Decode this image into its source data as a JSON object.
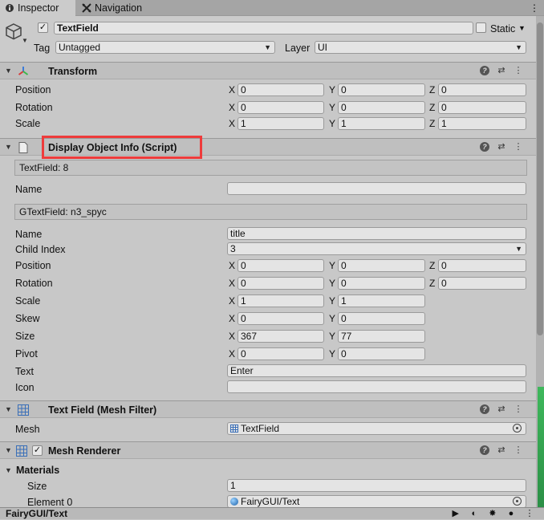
{
  "tabs": [
    {
      "label": "Inspector",
      "icon": "lock-info-icon",
      "active": true
    },
    {
      "label": "Navigation",
      "icon": "navigation-icon",
      "active": false
    }
  ],
  "tab_menu_icon": "kebab-menu-icon",
  "object": {
    "name": "TextField",
    "active_checked": true,
    "static_label": "Static",
    "tag_label": "Tag",
    "tag_value": "Untagged",
    "layer_label": "Layer",
    "layer_value": "UI"
  },
  "transform": {
    "title": "Transform",
    "position_label": "Position",
    "rotation_label": "Rotation",
    "scale_label": "Scale",
    "position": {
      "x": "0",
      "y": "0",
      "z": "0"
    },
    "rotation": {
      "x": "0",
      "y": "0",
      "z": "0"
    },
    "scale": {
      "x": "1",
      "y": "1",
      "z": "1"
    }
  },
  "axis": {
    "x": "X",
    "y": "Y",
    "z": "Z"
  },
  "display_info": {
    "title": "Display Object Info (Script)",
    "info1": "TextField: 8",
    "name_label1": "Name",
    "name_value1": "",
    "info2": "GTextField: n3_spyc",
    "name_label2": "Name",
    "name_value2": "title",
    "child_index_label": "Child Index",
    "child_index_value": "3",
    "position_label": "Position",
    "position": {
      "x": "0",
      "y": "0",
      "z": "0"
    },
    "rotation_label": "Rotation",
    "rotation": {
      "x": "0",
      "y": "0",
      "z": "0"
    },
    "scale_label": "Scale",
    "scale": {
      "x": "1",
      "y": "1"
    },
    "skew_label": "Skew",
    "skew": {
      "x": "0",
      "y": "0"
    },
    "size_label": "Size",
    "size": {
      "x": "367",
      "y": "77"
    },
    "pivot_label": "Pivot",
    "pivot": {
      "x": "0",
      "y": "0"
    },
    "text_label": "Text",
    "text_value": "Enter",
    "icon_label": "Icon",
    "icon_value": ""
  },
  "mesh_filter": {
    "title": "Text Field (Mesh Filter)",
    "mesh_label": "Mesh",
    "mesh_value": "TextField"
  },
  "mesh_renderer": {
    "title": "Mesh Renderer",
    "enabled": true,
    "materials_label": "Materials",
    "size_label": "Size",
    "size_value": "1",
    "element0_label": "Element 0",
    "element0_value": "FairyGUI/Text"
  },
  "footer": {
    "title": "FairyGUI/Text"
  },
  "colors": {
    "highlight": "#ee3b3b",
    "panel": "#c8c8c8",
    "header": "#bfbfbf"
  }
}
